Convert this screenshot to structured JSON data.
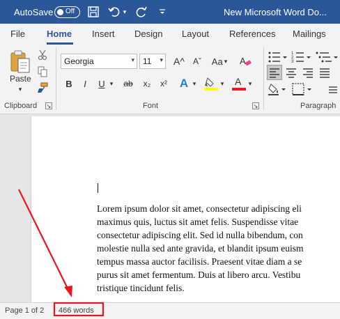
{
  "titlebar": {
    "autosave_label": "AutoSave",
    "autosave_state": "Off",
    "doc_title": "New Microsoft Word Do..."
  },
  "tabs": [
    "File",
    "Home",
    "Insert",
    "Design",
    "Layout",
    "References",
    "Mailings"
  ],
  "active_tab": "Home",
  "ribbon": {
    "paste_label": "Paste",
    "clipboard_label": "Clipboard",
    "font_name": "Georgia",
    "font_size": "11",
    "font_label": "Font",
    "paragraph_label": "Paragraph",
    "bold": "B",
    "italic": "I",
    "underline": "U",
    "strike": "ab",
    "subscript": "x₂",
    "superscript": "x²",
    "grow_font": "A^",
    "shrink_font": "Aˇ",
    "change_case": "Aa",
    "text_effects": "A",
    "font_color": "A",
    "highlight": "ab"
  },
  "document": {
    "lines": [
      "Lorem ipsum dolor sit amet, consectetur adipiscing eli",
      "maximus quis, luctus sit amet felis. Suspendisse vitae",
      "consectetur adipiscing elit. Sed id nulla bibendum, con",
      "molestie nulla sed ante gravida, et blandit ipsum euism",
      "tempus massa auctor facilisis. Praesent vitae diam a se",
      "purus sit amet fermentum. Duis at libero arcu. Vestibu",
      "tristique tincidunt felis."
    ]
  },
  "statusbar": {
    "page_info": "Page 1 of 2",
    "word_count": "466 words"
  },
  "colors": {
    "title_bg": "#2b579a",
    "annotation_red": "#e8161b",
    "highlight_yellow": "#ffff00",
    "font_red": "#e51c23"
  }
}
